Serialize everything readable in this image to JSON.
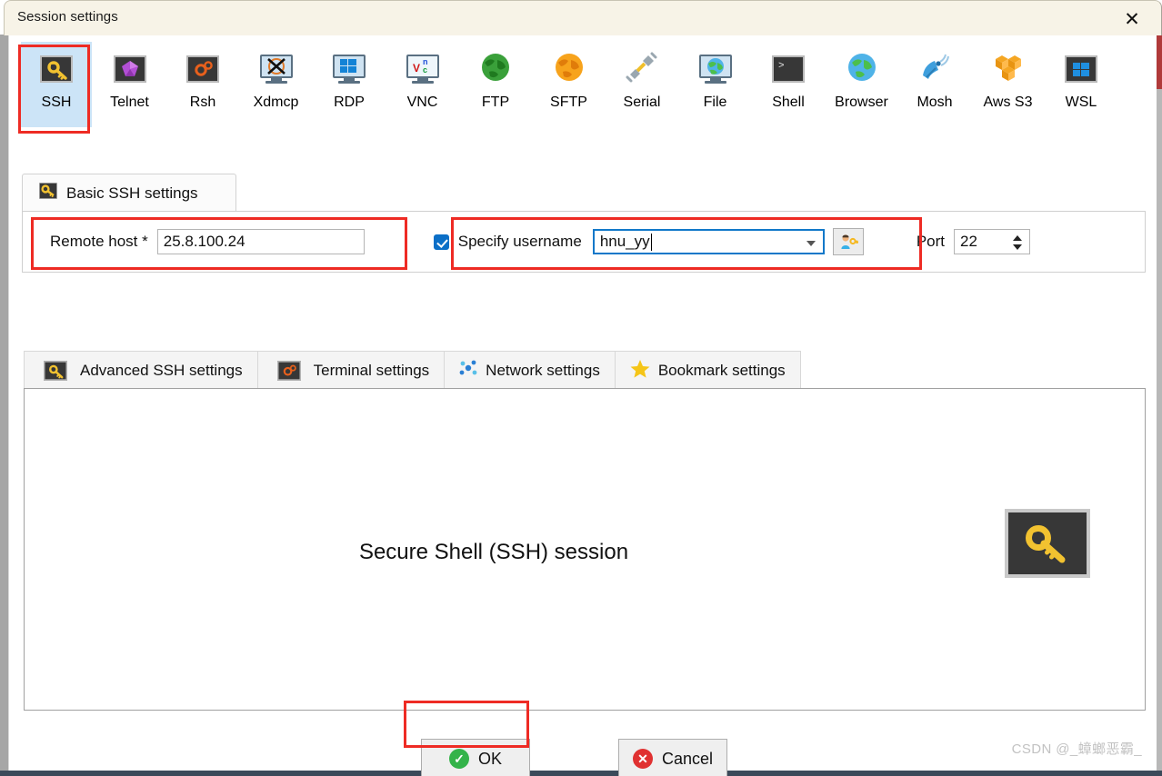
{
  "window": {
    "title": "Session settings",
    "close_label": "✕"
  },
  "protocols": [
    {
      "id": "ssh",
      "label": "SSH",
      "icon": "key-icon",
      "selected": true
    },
    {
      "id": "telnet",
      "label": "Telnet",
      "icon": "gem-icon",
      "selected": false
    },
    {
      "id": "rsh",
      "label": "Rsh",
      "icon": "gears-icon",
      "selected": false
    },
    {
      "id": "xdmcp",
      "label": "Xdmcp",
      "icon": "x-monitor-icon",
      "selected": false
    },
    {
      "id": "rdp",
      "label": "RDP",
      "icon": "windows-monitor-icon",
      "selected": false
    },
    {
      "id": "vnc",
      "label": "VNC",
      "icon": "vnc-monitor-icon",
      "selected": false
    },
    {
      "id": "ftp",
      "label": "FTP",
      "icon": "green-globe-icon",
      "selected": false
    },
    {
      "id": "sftp",
      "label": "SFTP",
      "icon": "orange-globe-icon",
      "selected": false
    },
    {
      "id": "serial",
      "label": "Serial",
      "icon": "plug-icon",
      "selected": false
    },
    {
      "id": "file",
      "label": "File",
      "icon": "globe-monitor-icon",
      "selected": false
    },
    {
      "id": "shell",
      "label": "Shell",
      "icon": "terminal-icon",
      "selected": false
    },
    {
      "id": "browser",
      "label": "Browser",
      "icon": "blue-globe-icon",
      "selected": false
    },
    {
      "id": "mosh",
      "label": "Mosh",
      "icon": "satellite-icon",
      "selected": false
    },
    {
      "id": "awss3",
      "label": "Aws S3",
      "icon": "aws-cubes-icon",
      "selected": false
    },
    {
      "id": "wsl",
      "label": "WSL",
      "icon": "windows-icon",
      "selected": false
    }
  ],
  "basic_tab": {
    "label": "Basic SSH settings",
    "icon": "key-icon"
  },
  "basic_settings": {
    "remote_host_label": "Remote host *",
    "remote_host_value": "25.8.100.24",
    "remote_host_placeholder": "",
    "specify_username_label": "Specify username",
    "specify_username_checked": true,
    "username_value": "hnu_yy",
    "username_placeholder": "",
    "user_button_icon": "user-key-icon",
    "port_label": "Port",
    "port_value": "22"
  },
  "settings_tabs": [
    {
      "id": "advanced",
      "label": "Advanced SSH settings",
      "icon": "key-icon"
    },
    {
      "id": "terminal",
      "label": "Terminal settings",
      "icon": "gears-icon"
    },
    {
      "id": "network",
      "label": "Network settings",
      "icon": "network-dots-icon"
    },
    {
      "id": "bookmark",
      "label": "Bookmark settings",
      "icon": "star-icon"
    }
  ],
  "content_panel": {
    "title": "Secure Shell (SSH) session",
    "icon": "key-icon"
  },
  "footer": {
    "ok_label": "OK",
    "ok_icon": "check-circle-icon",
    "cancel_label": "Cancel",
    "cancel_icon": "x-circle-icon"
  },
  "watermark": "CSDN @_蟑螂恶霸_",
  "colors": {
    "selection": "#cce4f7",
    "annotation": "#ee2b24",
    "accent_blue": "#0b6fc7",
    "titlebar": "#f7f3e7"
  }
}
